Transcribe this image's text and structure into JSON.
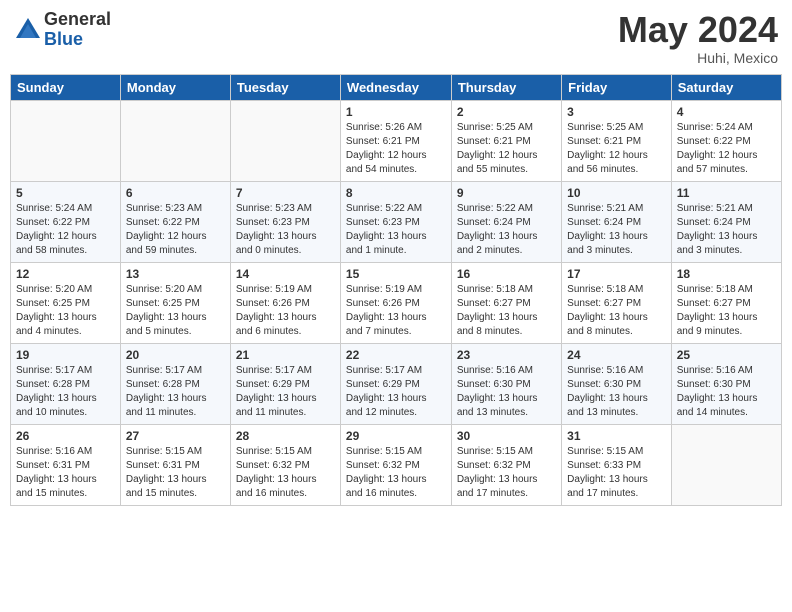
{
  "header": {
    "logo_general": "General",
    "logo_blue": "Blue",
    "month_title": "May 2024",
    "location": "Huhi, Mexico"
  },
  "weekdays": [
    "Sunday",
    "Monday",
    "Tuesday",
    "Wednesday",
    "Thursday",
    "Friday",
    "Saturday"
  ],
  "weeks": [
    [
      {
        "day": "",
        "info": ""
      },
      {
        "day": "",
        "info": ""
      },
      {
        "day": "",
        "info": ""
      },
      {
        "day": "1",
        "info": "Sunrise: 5:26 AM\nSunset: 6:21 PM\nDaylight: 12 hours\nand 54 minutes."
      },
      {
        "day": "2",
        "info": "Sunrise: 5:25 AM\nSunset: 6:21 PM\nDaylight: 12 hours\nand 55 minutes."
      },
      {
        "day": "3",
        "info": "Sunrise: 5:25 AM\nSunset: 6:21 PM\nDaylight: 12 hours\nand 56 minutes."
      },
      {
        "day": "4",
        "info": "Sunrise: 5:24 AM\nSunset: 6:22 PM\nDaylight: 12 hours\nand 57 minutes."
      }
    ],
    [
      {
        "day": "5",
        "info": "Sunrise: 5:24 AM\nSunset: 6:22 PM\nDaylight: 12 hours\nand 58 minutes."
      },
      {
        "day": "6",
        "info": "Sunrise: 5:23 AM\nSunset: 6:22 PM\nDaylight: 12 hours\nand 59 minutes."
      },
      {
        "day": "7",
        "info": "Sunrise: 5:23 AM\nSunset: 6:23 PM\nDaylight: 13 hours\nand 0 minutes."
      },
      {
        "day": "8",
        "info": "Sunrise: 5:22 AM\nSunset: 6:23 PM\nDaylight: 13 hours\nand 1 minute."
      },
      {
        "day": "9",
        "info": "Sunrise: 5:22 AM\nSunset: 6:24 PM\nDaylight: 13 hours\nand 2 minutes."
      },
      {
        "day": "10",
        "info": "Sunrise: 5:21 AM\nSunset: 6:24 PM\nDaylight: 13 hours\nand 3 minutes."
      },
      {
        "day": "11",
        "info": "Sunrise: 5:21 AM\nSunset: 6:24 PM\nDaylight: 13 hours\nand 3 minutes."
      }
    ],
    [
      {
        "day": "12",
        "info": "Sunrise: 5:20 AM\nSunset: 6:25 PM\nDaylight: 13 hours\nand 4 minutes."
      },
      {
        "day": "13",
        "info": "Sunrise: 5:20 AM\nSunset: 6:25 PM\nDaylight: 13 hours\nand 5 minutes."
      },
      {
        "day": "14",
        "info": "Sunrise: 5:19 AM\nSunset: 6:26 PM\nDaylight: 13 hours\nand 6 minutes."
      },
      {
        "day": "15",
        "info": "Sunrise: 5:19 AM\nSunset: 6:26 PM\nDaylight: 13 hours\nand 7 minutes."
      },
      {
        "day": "16",
        "info": "Sunrise: 5:18 AM\nSunset: 6:27 PM\nDaylight: 13 hours\nand 8 minutes."
      },
      {
        "day": "17",
        "info": "Sunrise: 5:18 AM\nSunset: 6:27 PM\nDaylight: 13 hours\nand 8 minutes."
      },
      {
        "day": "18",
        "info": "Sunrise: 5:18 AM\nSunset: 6:27 PM\nDaylight: 13 hours\nand 9 minutes."
      }
    ],
    [
      {
        "day": "19",
        "info": "Sunrise: 5:17 AM\nSunset: 6:28 PM\nDaylight: 13 hours\nand 10 minutes."
      },
      {
        "day": "20",
        "info": "Sunrise: 5:17 AM\nSunset: 6:28 PM\nDaylight: 13 hours\nand 11 minutes."
      },
      {
        "day": "21",
        "info": "Sunrise: 5:17 AM\nSunset: 6:29 PM\nDaylight: 13 hours\nand 11 minutes."
      },
      {
        "day": "22",
        "info": "Sunrise: 5:17 AM\nSunset: 6:29 PM\nDaylight: 13 hours\nand 12 minutes."
      },
      {
        "day": "23",
        "info": "Sunrise: 5:16 AM\nSunset: 6:30 PM\nDaylight: 13 hours\nand 13 minutes."
      },
      {
        "day": "24",
        "info": "Sunrise: 5:16 AM\nSunset: 6:30 PM\nDaylight: 13 hours\nand 13 minutes."
      },
      {
        "day": "25",
        "info": "Sunrise: 5:16 AM\nSunset: 6:30 PM\nDaylight: 13 hours\nand 14 minutes."
      }
    ],
    [
      {
        "day": "26",
        "info": "Sunrise: 5:16 AM\nSunset: 6:31 PM\nDaylight: 13 hours\nand 15 minutes."
      },
      {
        "day": "27",
        "info": "Sunrise: 5:15 AM\nSunset: 6:31 PM\nDaylight: 13 hours\nand 15 minutes."
      },
      {
        "day": "28",
        "info": "Sunrise: 5:15 AM\nSunset: 6:32 PM\nDaylight: 13 hours\nand 16 minutes."
      },
      {
        "day": "29",
        "info": "Sunrise: 5:15 AM\nSunset: 6:32 PM\nDaylight: 13 hours\nand 16 minutes."
      },
      {
        "day": "30",
        "info": "Sunrise: 5:15 AM\nSunset: 6:32 PM\nDaylight: 13 hours\nand 17 minutes."
      },
      {
        "day": "31",
        "info": "Sunrise: 5:15 AM\nSunset: 6:33 PM\nDaylight: 13 hours\nand 17 minutes."
      },
      {
        "day": "",
        "info": ""
      }
    ]
  ]
}
